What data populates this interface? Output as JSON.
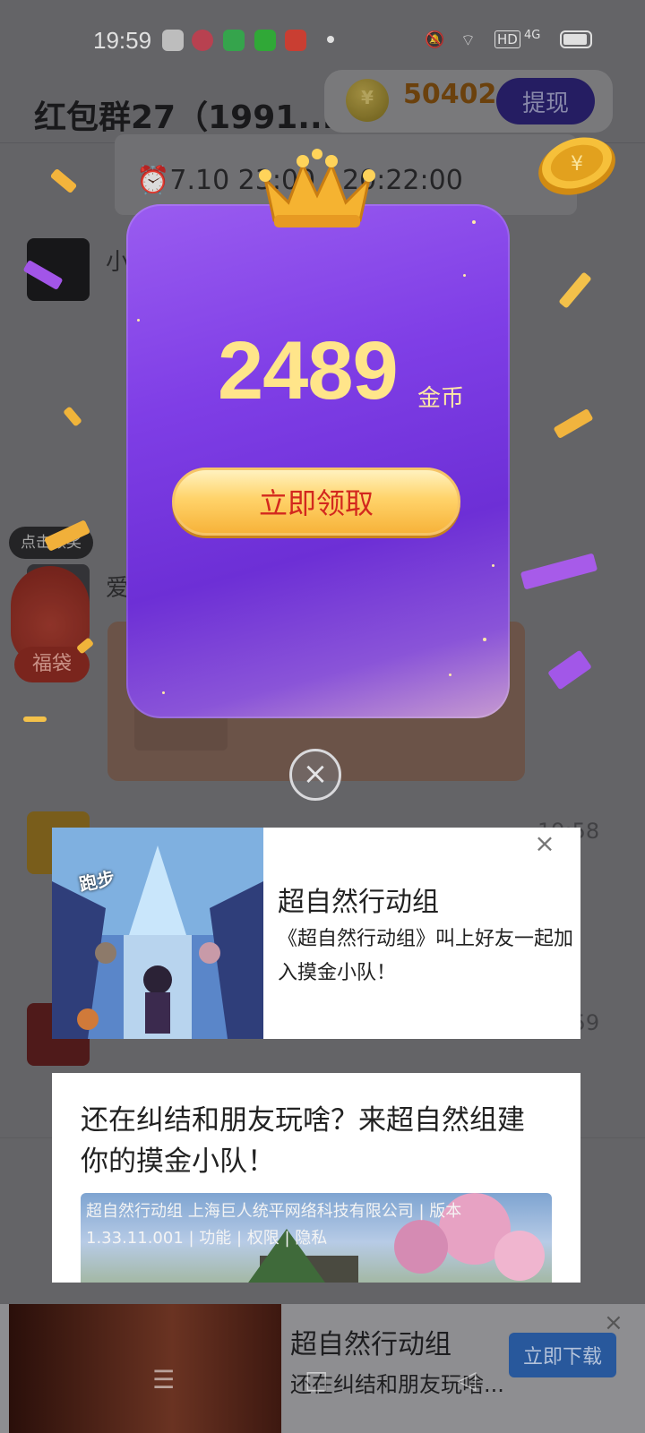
{
  "status_bar": {
    "time": "19:59",
    "network": "4G",
    "hd": "HD"
  },
  "chat": {
    "title": "红包群27（1991...",
    "coins": "50402",
    "withdraw_label": "提现",
    "notice_line": "⏰7.10 23:00 - 20:22:00",
    "sender_1": "小",
    "sender_2": "爱",
    "time_1": "19:58",
    "time_2": "19:59",
    "fudai_tag": "点击领奖",
    "fudai_label": "福袋"
  },
  "reward": {
    "amount": "2489",
    "unit": "金币",
    "claim_label": "立即领取",
    "close_symbol": "×"
  },
  "ad_1": {
    "image_caption": "跑步",
    "title": "超自然行动组",
    "description": "《超自然行动组》叫上好友一起加入摸金小队！"
  },
  "ad_2": {
    "headline": "还在纠结和朋友玩啥？来超自然组建你的摸金小队！",
    "meta": "超自然行动组 上海巨人统平网络科技有限公司 | 版本 1.33.11.001 | 功能 | 权限 | 隐私"
  },
  "ad_3": {
    "title": "超自然行动组",
    "description": "还在纠结和朋友玩啥...",
    "download_label": "立即下载"
  },
  "colors": {
    "purple_card": "#7f3ee6",
    "gold_text": "#ffe58a",
    "claim_text": "#d3281e",
    "download_button": "#28589c"
  },
  "icons": [
    "mute-icon",
    "wifi-icon",
    "signal-icon",
    "battery-icon",
    "crown-icon",
    "coin-icon",
    "close-icon",
    "menu-icon",
    "home-icon",
    "back-icon"
  ]
}
